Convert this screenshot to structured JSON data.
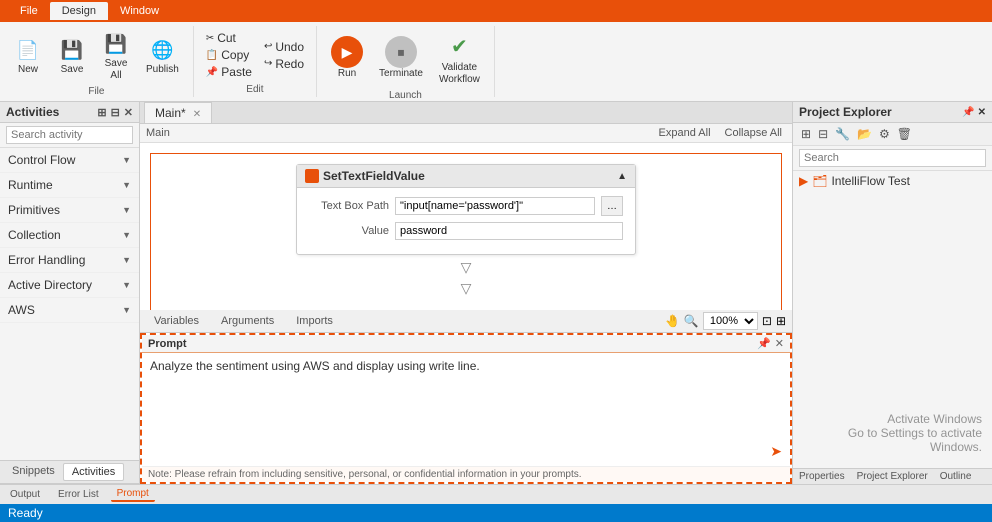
{
  "titleBar": {
    "tabs": [
      {
        "label": "File",
        "active": false
      },
      {
        "label": "Design",
        "active": true
      },
      {
        "label": "Window",
        "active": false
      }
    ]
  },
  "ribbon": {
    "groups": [
      {
        "name": "File",
        "label": "File",
        "buttons": [
          {
            "id": "new",
            "label": "New",
            "icon": "📄"
          },
          {
            "id": "save",
            "label": "Save",
            "icon": "💾"
          },
          {
            "id": "save-all",
            "label": "Save\nAll",
            "icon": "💾"
          },
          {
            "id": "publish",
            "label": "Publish",
            "icon": "🌐"
          }
        ]
      },
      {
        "name": "Edit",
        "label": "Edit",
        "smallButtons": [
          {
            "label": "Cut"
          },
          {
            "label": "Copy"
          },
          {
            "label": "Paste"
          },
          {
            "label": "Undo"
          },
          {
            "label": "Redo"
          }
        ]
      },
      {
        "name": "Launch",
        "label": "Launch",
        "buttons": [
          {
            "id": "run",
            "label": "Run",
            "type": "run"
          },
          {
            "id": "terminate",
            "label": "Terminate",
            "type": "terminate"
          },
          {
            "id": "validate",
            "label": "Validate\nWorkflow",
            "type": "validate"
          }
        ]
      }
    ]
  },
  "leftPanel": {
    "title": "Activities",
    "searchPlaceholder": "Search activity",
    "navItems": [
      {
        "label": "Control Flow"
      },
      {
        "label": "Runtime"
      },
      {
        "label": "Primitives"
      },
      {
        "label": "Collection"
      },
      {
        "label": "Error Handling"
      },
      {
        "label": "Active Directory"
      },
      {
        "label": "AWS"
      }
    ],
    "bottomTabs": [
      {
        "label": "Snippets",
        "active": false
      },
      {
        "label": "Activities",
        "active": true
      }
    ]
  },
  "editorTabs": [
    {
      "label": "Main*",
      "active": true,
      "closable": true
    }
  ],
  "canvas": {
    "breadcrumb": "Main",
    "expandAll": "Expand All",
    "collapseAll": "Collapse All",
    "activityCard": {
      "title": "SetTextFieldValue",
      "fields": [
        {
          "label": "Text Box Path",
          "value": "\"input[name='password']\""
        },
        {
          "label": "Value",
          "value": "password"
        }
      ]
    }
  },
  "bottomToolbar": {
    "zoom": "100%",
    "tabs": [
      {
        "label": "Variables",
        "active": false
      },
      {
        "label": "Arguments",
        "active": false
      },
      {
        "label": "Imports",
        "active": false
      }
    ]
  },
  "promptSection": {
    "title": "Prompt",
    "text": "Analyze the sentiment using AWS and display using write line.",
    "note": "Note: Please refrain from including sensitive, personal, or confidential information in your prompts.",
    "sendIcon": "➤"
  },
  "veryBottomTabs": [
    {
      "label": "Output",
      "active": false
    },
    {
      "label": "Error List",
      "active": false
    },
    {
      "label": "Prompt",
      "active": true
    }
  ],
  "statusBar": {
    "text": "Ready"
  },
  "rightPanel": {
    "title": "Project Explorer",
    "treeItems": [
      {
        "label": "IntelliFlow Test",
        "icon": "🗂"
      }
    ],
    "bottomTabs": [
      {
        "label": "Properties",
        "active": false
      },
      {
        "label": "Project Explorer",
        "active": false
      },
      {
        "label": "Outline",
        "active": false
      }
    ]
  },
  "activateOverlay": {
    "line1": "Activate Windows",
    "line2": "Go to Settings to activate Windows."
  }
}
